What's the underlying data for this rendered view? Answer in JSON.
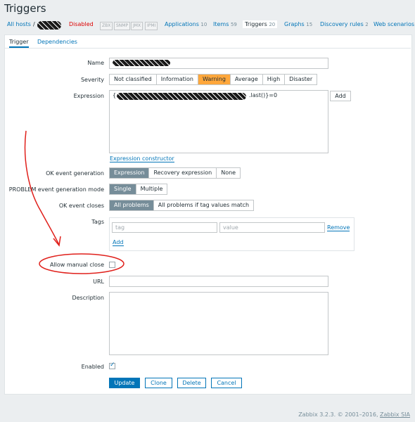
{
  "page_title": "Triggers",
  "nav": {
    "all_hosts": "All hosts",
    "separator": "/",
    "status": "Disabled",
    "tags": [
      "ZBX",
      "SNMP",
      "JMX",
      "IPMI"
    ],
    "applications": {
      "label": "Applications",
      "count": "10"
    },
    "items": {
      "label": "Items",
      "count": "59"
    },
    "triggers": {
      "label": "Triggers",
      "count": "20"
    },
    "graphs": {
      "label": "Graphs",
      "count": "15"
    },
    "discovery": {
      "label": "Discovery rules",
      "count": "2"
    },
    "web": {
      "label": "Web scenarios"
    }
  },
  "tabs": [
    "Trigger",
    "Dependencies"
  ],
  "form": {
    "name_label": "Name",
    "severity_label": "Severity",
    "severity_options": [
      "Not classified",
      "Information",
      "Warning",
      "Average",
      "High",
      "Disaster"
    ],
    "severity_selected": "Warning",
    "expression_label": "Expression",
    "expression_suffix": ".last()}=0",
    "expression_prefix": "{",
    "add_button": "Add",
    "expression_constructor": "Expression constructor",
    "ok_event_generation_label": "OK event generation",
    "ok_event_generation_options": [
      "Expression",
      "Recovery expression",
      "None"
    ],
    "problem_mode_label": "PROBLEM event generation mode",
    "problem_mode_options": [
      "Single",
      "Multiple"
    ],
    "ok_event_closes_label": "OK event closes",
    "ok_event_closes_options": [
      "All problems",
      "All problems if tag values match"
    ],
    "tags_label": "Tags",
    "tag_placeholder": "tag",
    "value_placeholder": "value",
    "remove_link": "Remove",
    "add_link": "Add",
    "allow_manual_close_label": "Allow manual close",
    "allow_manual_close_checked": false,
    "url_label": "URL",
    "description_label": "Description",
    "enabled_label": "Enabled",
    "enabled_checked": true
  },
  "buttons": {
    "update": "Update",
    "clone": "Clone",
    "delete": "Delete",
    "cancel": "Cancel"
  },
  "footer": {
    "version": "Zabbix 3.2.3. © 2001–2016,",
    "company": "Zabbix SIA"
  },
  "colors": {
    "accent": "#0275b8",
    "warning": "#ffa73b",
    "annotation": "#e0201b",
    "disabled": "#dc0000"
  }
}
